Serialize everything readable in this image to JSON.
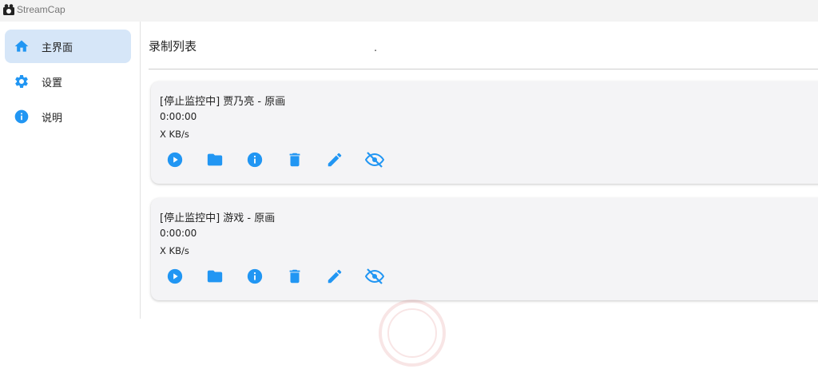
{
  "app": {
    "title": "StreamCap"
  },
  "colors": {
    "accent": "#2196f3",
    "nav_active_bg": "#d6e6f8",
    "card_bg": "#f4f4f6"
  },
  "sidebar": {
    "items": [
      {
        "label": "主界面",
        "icon": "home-icon",
        "active": true
      },
      {
        "label": "设置",
        "icon": "gear-icon",
        "active": false
      },
      {
        "label": "说明",
        "icon": "info-icon",
        "active": false
      }
    ]
  },
  "main": {
    "title": "录制列表",
    "stray_text": ".",
    "recordings": [
      {
        "status_line": "[停止监控中] 贾乃亮 - 原画",
        "duration": "0:00:00",
        "speed": "X KB/s",
        "actions": [
          "play-icon",
          "folder-icon",
          "info-icon",
          "delete-icon",
          "edit-icon",
          "visibility-off-icon"
        ]
      },
      {
        "status_line": "[停止监控中] 游戏 - 原画",
        "duration": "0:00:00",
        "speed": "X KB/s",
        "actions": [
          "play-icon",
          "folder-icon",
          "info-icon",
          "delete-icon",
          "edit-icon",
          "visibility-off-icon"
        ]
      }
    ]
  }
}
